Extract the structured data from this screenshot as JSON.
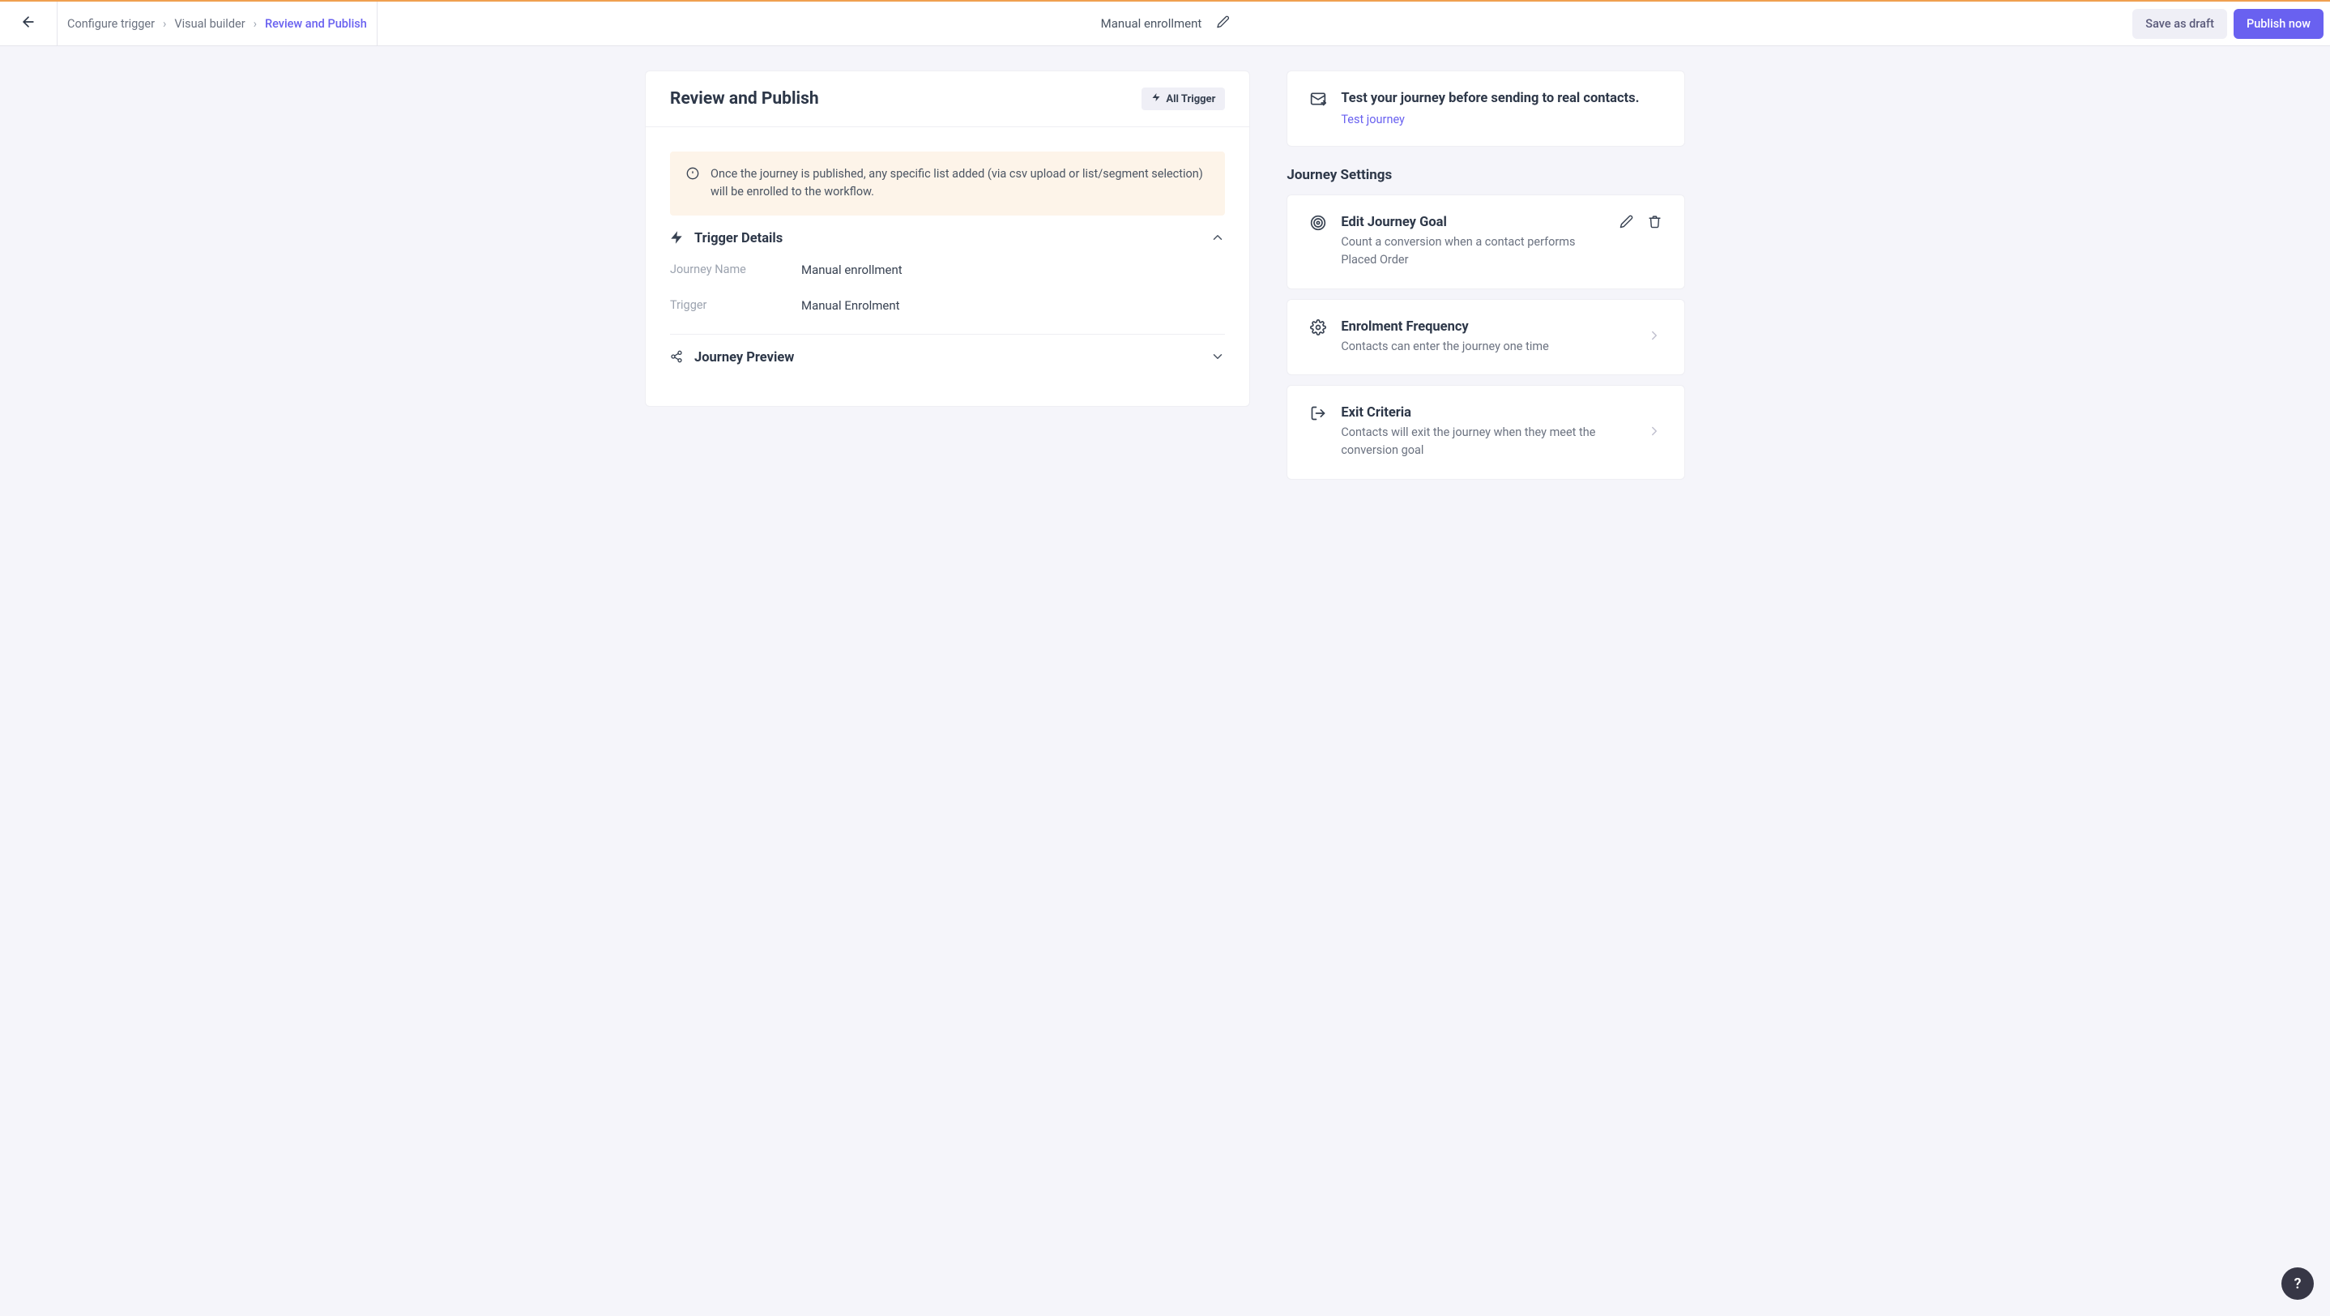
{
  "topbar": {
    "breadcrumbs": {
      "items": [
        "Configure trigger",
        "Visual builder",
        "Review and Publish"
      ]
    },
    "title": "Manual enrollment",
    "save_draft_label": "Save as draft",
    "publish_label": "Publish now"
  },
  "review": {
    "heading": "Review and Publish",
    "all_trigger_label": "All Trigger",
    "banner": "Once the journey is published, any specific list added (via csv upload or list/segment selection) will be enrolled to the workflow.",
    "trigger_details": {
      "title": "Trigger Details",
      "journey_name_label": "Journey Name",
      "journey_name_value": "Manual enrollment",
      "trigger_label": "Trigger",
      "trigger_value": "Manual Enrolment"
    },
    "journey_preview_title": "Journey Preview"
  },
  "test": {
    "title": "Test your journey before sending to real contacts.",
    "link": "Test journey"
  },
  "settings": {
    "heading": "Journey Settings",
    "goal": {
      "title": "Edit Journey Goal",
      "sub": "Count a conversion when a contact performs Placed Order"
    },
    "freq": {
      "title": "Enrolment Frequency",
      "sub": "Contacts can enter the journey one time"
    },
    "exit": {
      "title": "Exit Criteria",
      "sub": "Contacts will exit the journey when they meet the conversion goal"
    }
  },
  "help": "?"
}
